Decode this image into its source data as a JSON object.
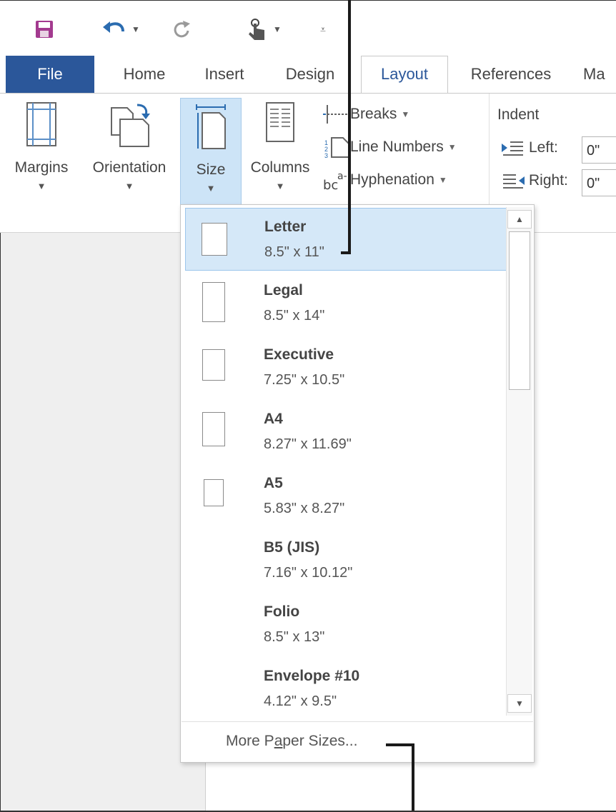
{
  "qat": {
    "save_icon": "save-icon",
    "undo_icon": "undo-icon",
    "redo_icon": "redo-icon",
    "touch_icon": "touch-mode-icon",
    "customize_icon": "customize-qat-icon"
  },
  "tabs": [
    {
      "label": "File"
    },
    {
      "label": "Home"
    },
    {
      "label": "Insert"
    },
    {
      "label": "Design"
    },
    {
      "label": "Layout"
    },
    {
      "label": "References"
    },
    {
      "label": "Ma"
    }
  ],
  "ribbon": {
    "margins": "Margins",
    "orientation": "Orientation",
    "size": "Size",
    "columns": "Columns",
    "breaks": "Breaks",
    "line_numbers": "Line Numbers",
    "hyphenation": "Hyphenation",
    "indent": "Indent",
    "left_label": "Left:",
    "left_value": "0\"",
    "right_label": "Right:",
    "right_value": "0\""
  },
  "size_menu": {
    "items": [
      {
        "name": "Letter",
        "dims": "8.5\" x 11\""
      },
      {
        "name": "Legal",
        "dims": "8.5\" x 14\""
      },
      {
        "name": "Executive",
        "dims": "7.25\" x 10.5\""
      },
      {
        "name": "A4",
        "dims": "8.27\" x 11.69\""
      },
      {
        "name": "A5",
        "dims": "5.83\" x 8.27\""
      },
      {
        "name": "B5 (JIS)",
        "dims": "7.16\" x 10.12\""
      },
      {
        "name": "Folio",
        "dims": "8.5\" x 13\""
      },
      {
        "name": "Envelope #10",
        "dims": "4.12\" x 9.5\""
      }
    ],
    "more_pre": "More P",
    "more_accel": "a",
    "more_post": "per Sizes..."
  },
  "colors": {
    "accent": "#2b579a",
    "selected": "#d5e8f8"
  }
}
